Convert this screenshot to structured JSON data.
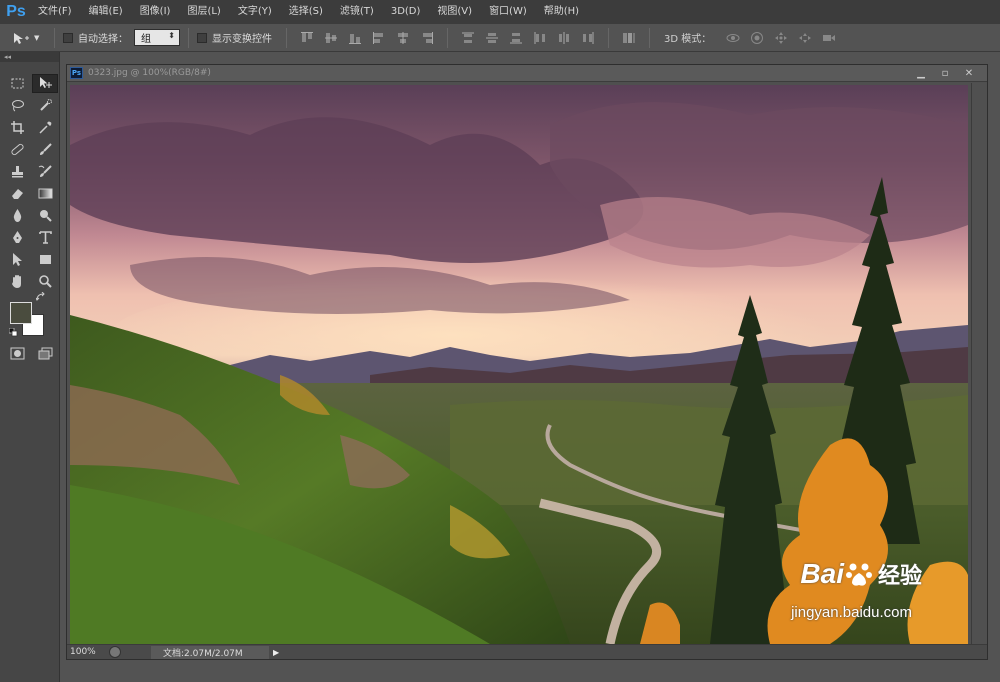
{
  "app": {
    "logo": "Ps"
  },
  "menu": [
    "文件(F)",
    "编辑(E)",
    "图像(I)",
    "图层(L)",
    "文字(Y)",
    "选择(S)",
    "滤镜(T)",
    "3D(D)",
    "视图(V)",
    "窗口(W)",
    "帮助(H)"
  ],
  "options": {
    "auto_select_label": "自动选择：",
    "auto_select_value": "组",
    "show_transform_label": "显示变换控件",
    "mode_3d_label": "3D 模式："
  },
  "document": {
    "title": "0323.jpg @ 100%(RGB/8#)",
    "zoom": "100%",
    "doc_size": "文档:2.07M/2.07M"
  },
  "watermark": {
    "brand": "Bai",
    "product": "经验",
    "url": "jingyan.baidu.com"
  },
  "colors": {
    "foreground": "#4a4c3e",
    "background": "#ffffff",
    "accent": "#3fa0f0"
  }
}
